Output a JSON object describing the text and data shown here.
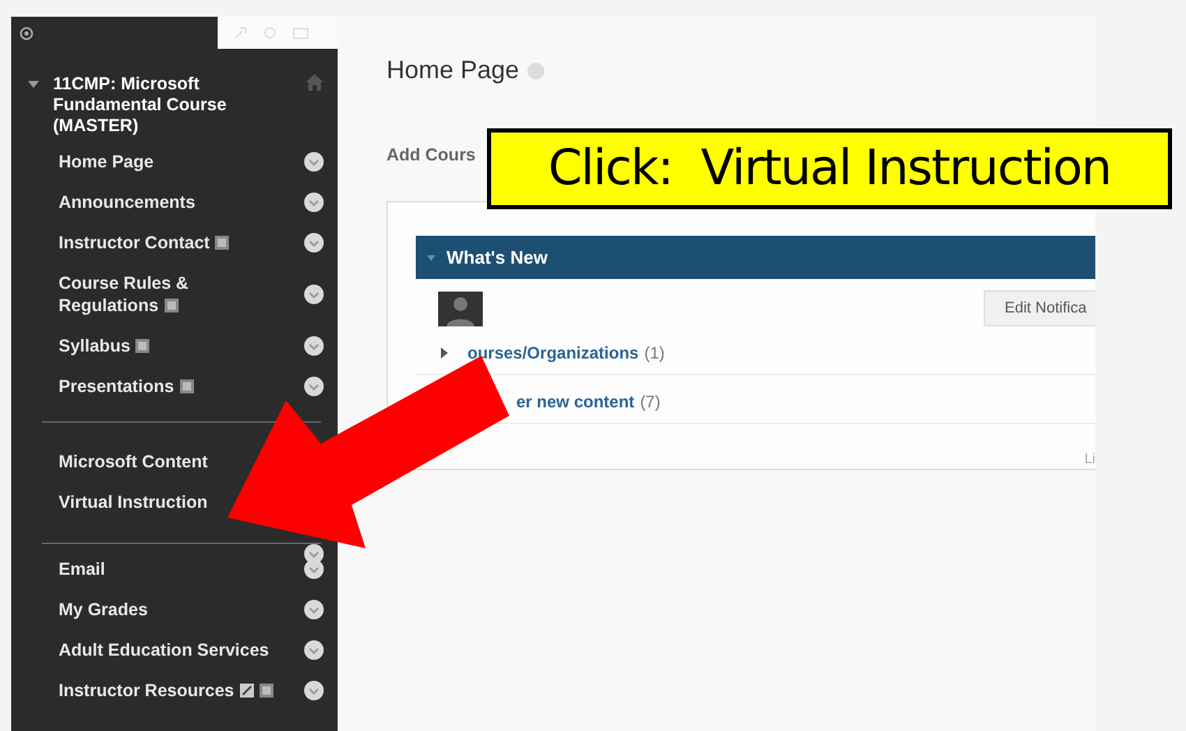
{
  "sidebar": {
    "course_title": "11CMP: Microsoft Fundamental Course (MASTER)",
    "expanded": true,
    "groups": [
      {
        "items": [
          {
            "label": "Home Page",
            "menu": true
          },
          {
            "label": "Announcements",
            "menu": true
          },
          {
            "label": "Instructor Contact",
            "menu": true,
            "page_icon": true
          },
          {
            "label": "Course Rules & Regulations",
            "menu": true,
            "page_icon": true
          },
          {
            "label": "Syllabus",
            "menu": true,
            "page_icon": true
          },
          {
            "label": "Presentations",
            "menu": true,
            "page_icon": true
          }
        ]
      },
      {
        "items": [
          {
            "label": "Microsoft Content",
            "menu": false
          },
          {
            "label": "Virtual Instruction",
            "menu": false
          }
        ]
      },
      {
        "items": [
          {
            "label": "Email",
            "menu": true
          },
          {
            "label": "My Grades",
            "menu": true
          },
          {
            "label": "Adult Education Services",
            "menu": true
          },
          {
            "label": "Instructor Resources",
            "menu": true,
            "edit_icon": true,
            "page_icon": true
          }
        ]
      }
    ]
  },
  "main": {
    "title": "Home Page",
    "add_link": "Add Cours",
    "module": {
      "title": "What's New",
      "button": "Edit Notifica",
      "rows": [
        {
          "link": "ourses/Organizations",
          "count": "(1)",
          "expander": true
        },
        {
          "link": "er new content",
          "count": "(7)",
          "expander": false
        }
      ],
      "footer": "Li"
    }
  },
  "callout": {
    "text": "Click:  Virtual Instruction"
  }
}
